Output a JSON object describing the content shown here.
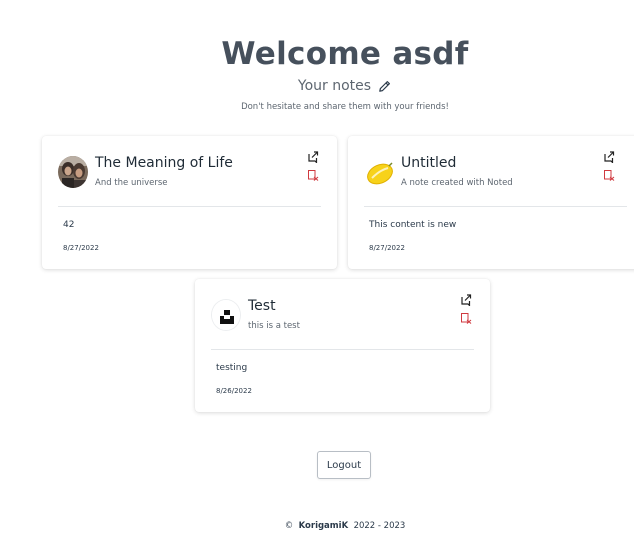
{
  "header": {
    "welcome": "Welcome asdf",
    "subtitle": "Your notes",
    "tagline": "Don't hesitate and share them with your friends!"
  },
  "notes": [
    {
      "title": "The Meaning of Life",
      "subtitle": "And the universe",
      "content": "42",
      "date": "8/27/2022",
      "icon": "photo-avatar"
    },
    {
      "title": "Untitled",
      "subtitle": "A note created with Noted",
      "content": "This content is new",
      "date": "8/27/2022",
      "icon": "lemon-icon"
    },
    {
      "title": "Test",
      "subtitle": "this is a test",
      "content": "testing",
      "date": "8/26/2022",
      "icon": "unsplash-icon"
    }
  ],
  "actions": {
    "share_icon": "share-icon",
    "delete_icon": "delete-icon"
  },
  "logout_label": "Logout",
  "footer": {
    "copyright": "©",
    "brand": "KorigamiK",
    "years": "2022 - 2023"
  },
  "colors": {
    "title": "#46505c",
    "delete": "#d0393f",
    "divider": "#e3e6e9"
  }
}
